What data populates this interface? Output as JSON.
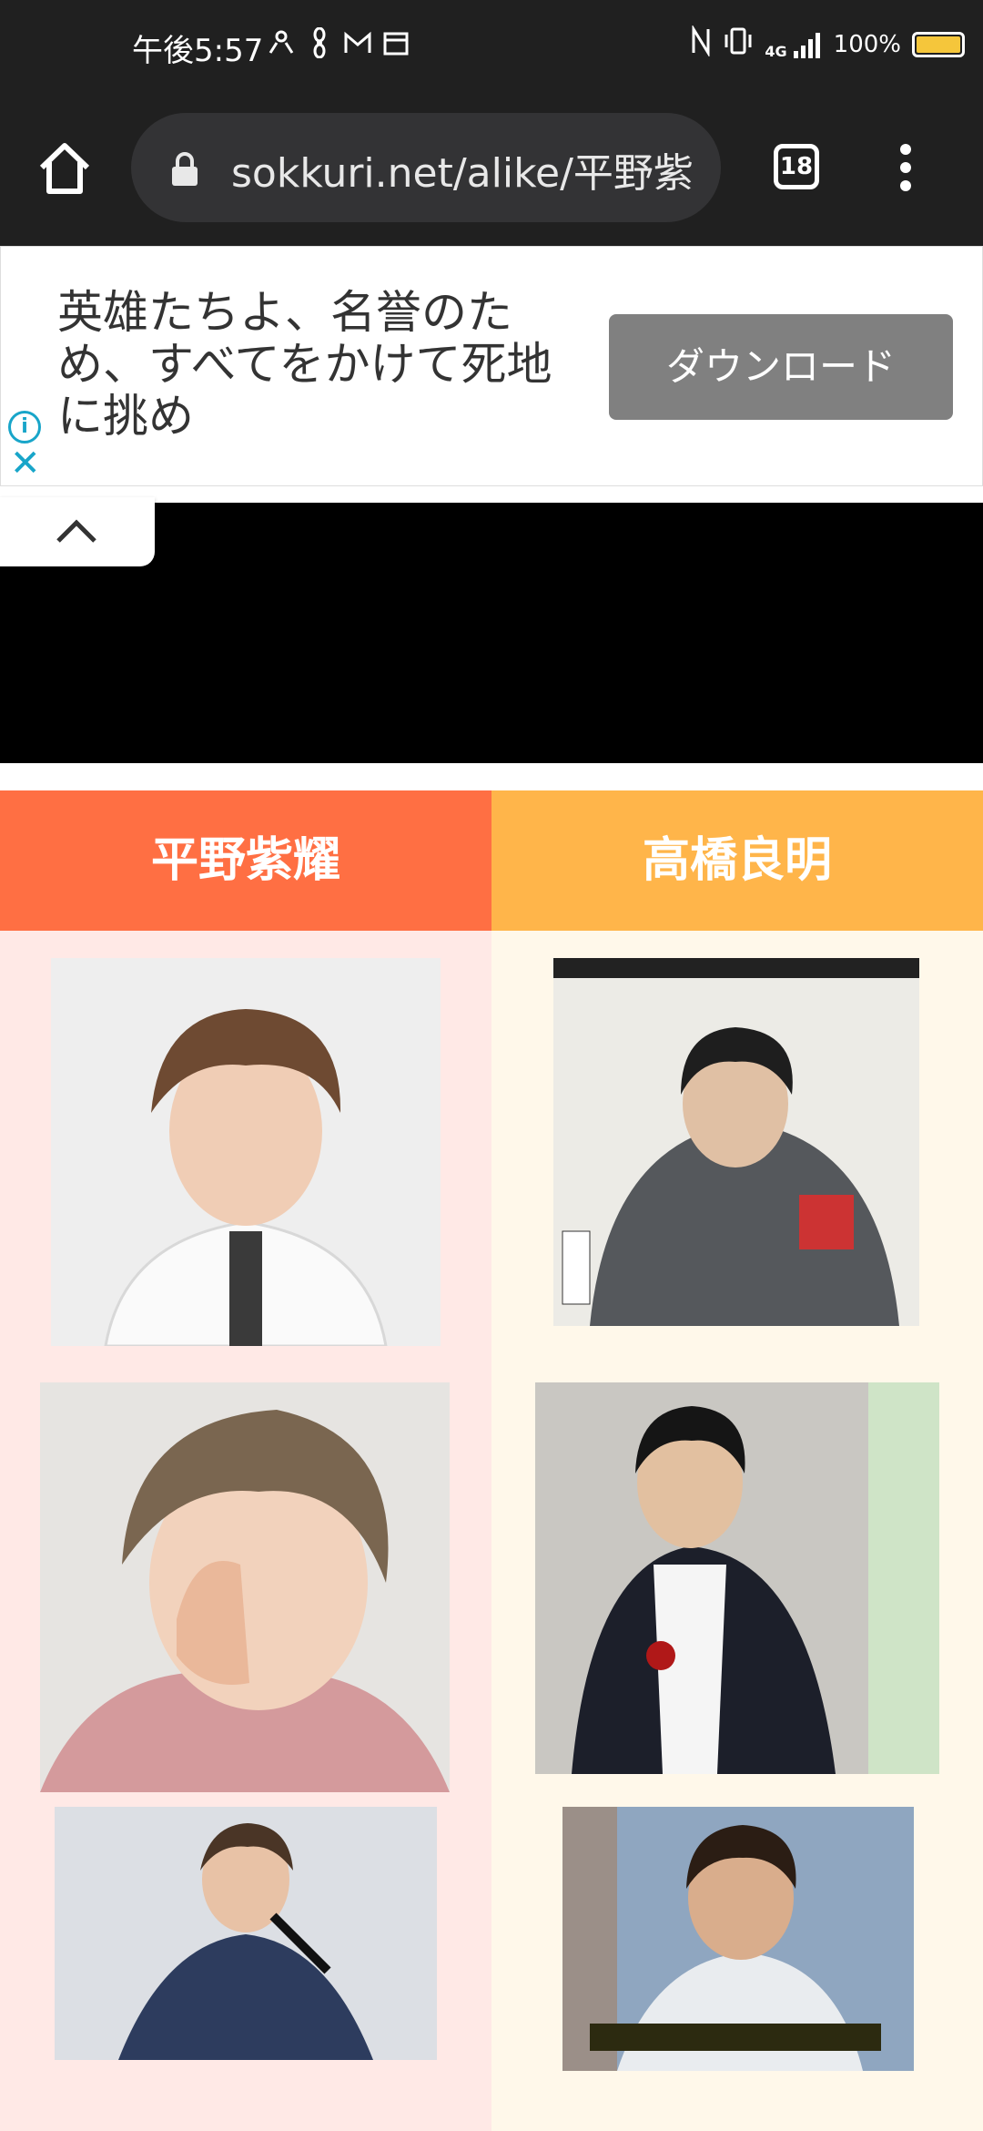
{
  "status_bar": {
    "time": "午後5:57",
    "battery": "100%",
    "network": "4G",
    "icons": [
      "people-icon",
      "fan-icon",
      "gmail-icon",
      "calendar-icon",
      "nfc-icon",
      "vibrate-icon",
      "signal-icon",
      "battery-charging-icon"
    ]
  },
  "browser": {
    "url": "sokkuri.net/alike/平野紫",
    "tab_count": "18"
  },
  "ad": {
    "text": "英雄たちよ、名誉のため、すべてをかけて死地に挑め",
    "button_label": "ダウンロード",
    "info_symbol": "i",
    "close_symbol": "✕"
  },
  "comparison": {
    "left_name": "平野紫耀",
    "right_name": "高橋良明",
    "colors": {
      "left_header": "#ff6f43",
      "right_header": "#ffb54a",
      "left_bg": "#ffe9e6",
      "right_bg": "#fff8ea"
    }
  }
}
